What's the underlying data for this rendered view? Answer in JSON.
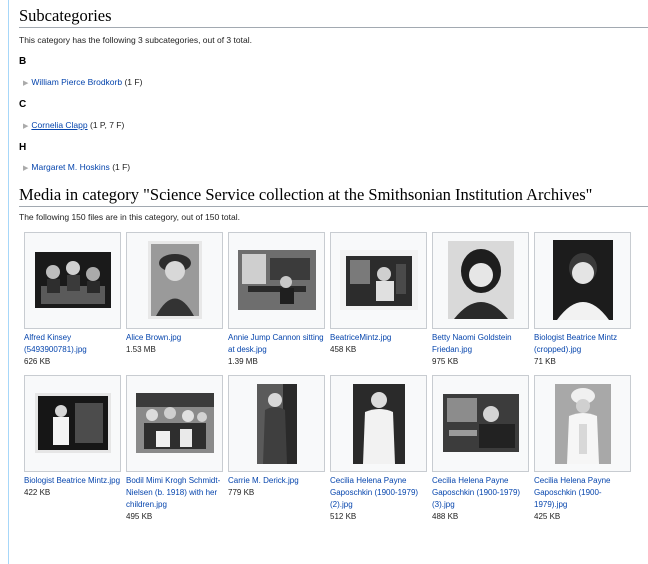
{
  "subcategories": {
    "heading": "Subcategories",
    "summary": "This category has the following 3 subcategories, out of 3 total.",
    "groups": [
      {
        "letter": "B",
        "name": "William Pierce Brodkorb",
        "count": "(1 F)"
      },
      {
        "letter": "C",
        "name": "Cornelia Clapp",
        "count": "(1 P, 7 F)"
      },
      {
        "letter": "H",
        "name": "Margaret M. Hoskins",
        "count": "(1 F)"
      }
    ]
  },
  "media": {
    "heading": "Media in category \"Science Service collection at the Smithsonian Institution Archives\"",
    "summary": "The following 150 files are in this category, out of 150 total.",
    "files": [
      {
        "name": "Alfred Kinsey (5493900781).jpg",
        "size": "626 KB"
      },
      {
        "name": "Alice Brown.jpg",
        "size": "1.53 MB"
      },
      {
        "name": "Annie Jump Cannon sitting at desk.jpg",
        "size": "1.39 MB"
      },
      {
        "name": "BeatriceMintz.jpg",
        "size": "458 KB"
      },
      {
        "name": "Betty Naomi Goldstein Friedan.jpg",
        "size": "975 KB"
      },
      {
        "name": "Biologist Beatrice Mintz (cropped).jpg",
        "size": "71 KB"
      },
      {
        "name": "Biologist Beatrice Mintz.jpg",
        "size": "422 KB"
      },
      {
        "name": "Bodil Mimi Krogh Schmidt-Nielsen (b. 1918) with her children.jpg",
        "size": "495 KB"
      },
      {
        "name": "Carrie M. Derick.jpg",
        "size": "779 KB"
      },
      {
        "name": "Cecilia Helena Payne Gaposchkin (1900-1979) (2).jpg",
        "size": "512 KB"
      },
      {
        "name": "Cecilia Helena Payne Gaposchkin (1900-1979) (3).jpg",
        "size": "488 KB"
      },
      {
        "name": "Cecilia Helena Payne Gaposchkin (1900-1979).jpg",
        "size": "425 KB"
      }
    ]
  },
  "icons": {
    "bullet": "triangle-bullet-icon"
  }
}
